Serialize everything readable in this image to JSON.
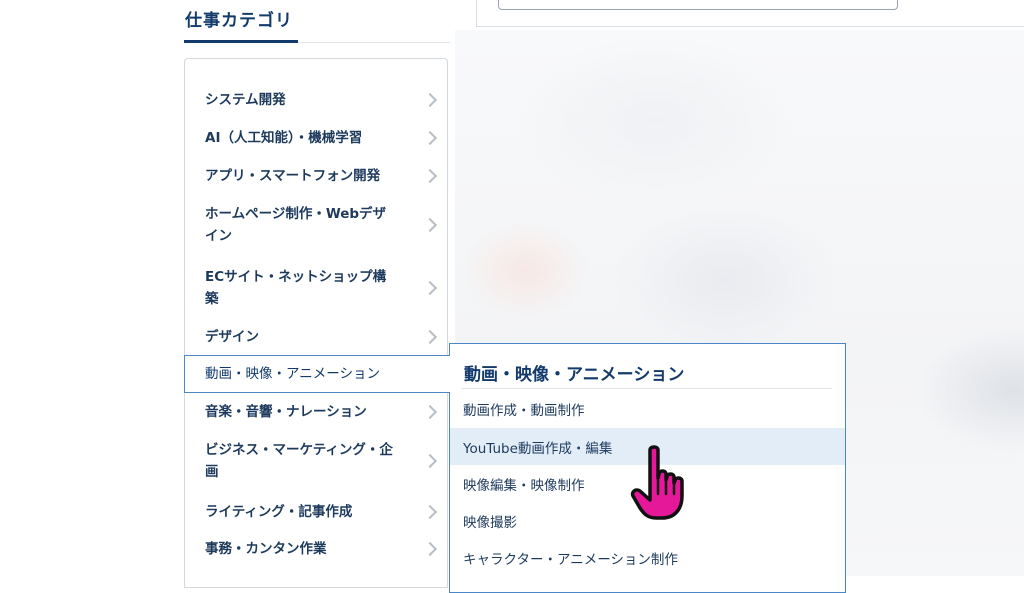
{
  "section": {
    "title": "仕事カテゴリ"
  },
  "categories": [
    {
      "label_lines": [
        "システム開発"
      ]
    },
    {
      "label_lines": [
        "AI（人工知能）・機械学習"
      ]
    },
    {
      "label_lines": [
        "アプリ・スマートフォン開発"
      ]
    },
    {
      "label_lines": [
        "ホームページ制作・Webデザ",
        "イン"
      ]
    },
    {
      "label_lines": [
        "ECサイト・ネットショップ構",
        "築"
      ]
    },
    {
      "label_lines": [
        "デザイン"
      ]
    },
    {
      "label_lines": [
        "動画・映像・アニメーション"
      ],
      "active": true
    },
    {
      "label_lines": [
        "音楽・音響・ナレーション"
      ]
    },
    {
      "label_lines": [
        "ビジネス・マーケティング・企",
        "画"
      ]
    },
    {
      "label_lines": [
        "ライティング・記事作成"
      ]
    },
    {
      "label_lines": [
        "事務・カンタン作業"
      ]
    }
  ],
  "submenu": {
    "title": "動画・映像・アニメーション",
    "items": [
      {
        "label": "動画作成・動画制作"
      },
      {
        "label": "YouTube動画作成・編集",
        "hovered": true
      },
      {
        "label": "映像編集・映像制作"
      },
      {
        "label": "映像撮影"
      },
      {
        "label": "キャラクター・アニメーション制作"
      }
    ]
  },
  "colors": {
    "primary_navy": "#123a6c",
    "active_border": "#4b86c8",
    "hover_bg": "#e3edf8",
    "cursor": "#e5189a"
  },
  "icons": {
    "chevron": "chevron-right-icon",
    "cursor": "hand-pointer-icon"
  }
}
